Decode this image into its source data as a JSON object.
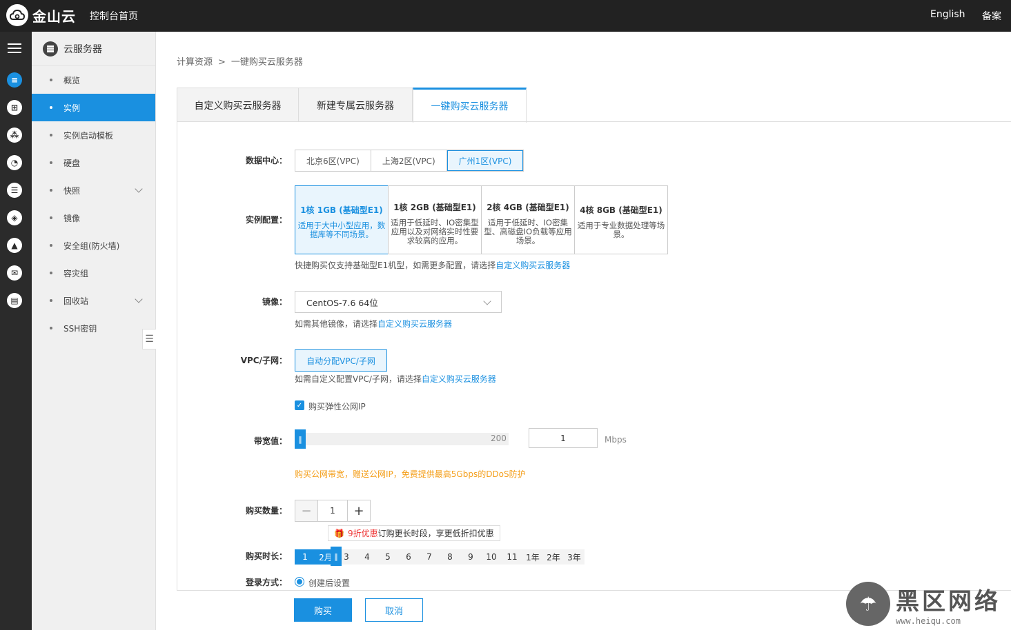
{
  "topbar": {
    "logo_text": "金山云",
    "home_link": "控制台首页",
    "english_link": "English",
    "beian_link": "备案"
  },
  "sidebar": {
    "title": "云服务器",
    "items": [
      {
        "label": "概览"
      },
      {
        "label": "实例",
        "active": true
      },
      {
        "label": "实例启动模板"
      },
      {
        "label": "硬盘"
      },
      {
        "label": "快照",
        "expandable": true
      },
      {
        "label": "镜像"
      },
      {
        "label": "安全组(防火墙)"
      },
      {
        "label": "容灾组"
      },
      {
        "label": "回收站",
        "expandable": true
      },
      {
        "label": "SSH密钥"
      }
    ]
  },
  "breadcrumb": {
    "parent": "计算资源",
    "separator": ">",
    "current": "一键购买云服务器"
  },
  "tabs": [
    {
      "label": "自定义购买云服务器"
    },
    {
      "label": "新建专属云服务器"
    },
    {
      "label": "一键购买云服务器",
      "active": true
    }
  ],
  "form": {
    "datacenter": {
      "label": "数据中心：",
      "options": [
        "北京6区(VPC)",
        "上海2区(VPC)",
        "广州1区(VPC)"
      ],
      "selected": "广州1区(VPC)"
    },
    "instance": {
      "label": "实例配置：",
      "cards": [
        {
          "title": "1核 1GB (基础型E1)",
          "desc": "适用于大中小型应用，数据库等不同场景。",
          "selected": true
        },
        {
          "title": "1核 2GB (基础型E1)",
          "desc": "适用于低延时、IO密集型应用以及对网络实时性要求较高的应用。"
        },
        {
          "title": "2核 4GB (基础型E1)",
          "desc": "适用于低延时、IO密集型、高磁盘IO负载等应用场景。"
        },
        {
          "title": "4核 8GB (基础型E1)",
          "desc": "适用于专业数据处理等场景。"
        }
      ],
      "hint_prefix": "快捷购买仅支持基础型E1机型，如需更多配置，请选择",
      "hint_link": "自定义购买云服务器"
    },
    "image": {
      "label": "镜像：",
      "value": "CentOS-7.6 64位",
      "hint_prefix": "如需其他镜像，请选择",
      "hint_link": "自定义购买云服务器"
    },
    "vpc": {
      "label": "VPC/子网：",
      "button": "自动分配VPC/子网",
      "hint_prefix": "如需自定义配置VPC/子网，请选择",
      "hint_link": "自定义购买云服务器"
    },
    "eip": {
      "checkbox_label": "购买弹性公网IP",
      "checked": true
    },
    "bandwidth": {
      "label": "带宽值：",
      "max": "200",
      "value": "1",
      "unit": "Mbps",
      "warning": "购买公网带宽，赠送公网IP，免费提供最高5Gbps的DDoS防护"
    },
    "quantity": {
      "label": "购买数量：",
      "value": "1"
    },
    "promo": {
      "highlight": "9折优惠",
      "text": "订购更长时段，享更低折扣优惠"
    },
    "duration": {
      "label": "购买时长：",
      "options": [
        "1",
        "2月",
        "3",
        "4",
        "5",
        "6",
        "7",
        "8",
        "9",
        "10",
        "11",
        "1年",
        "2年",
        "3年"
      ]
    },
    "login": {
      "label": "登录方式：",
      "option": "创建后设置"
    }
  },
  "footer": {
    "buy_button": "购买",
    "cancel_button": "取消"
  },
  "watermark": {
    "title": "黑区网络",
    "url": "www.heiqu.com"
  },
  "colors": {
    "accent": "#1a90e0",
    "topbar": "#222222",
    "warning": "#f49f1b"
  }
}
